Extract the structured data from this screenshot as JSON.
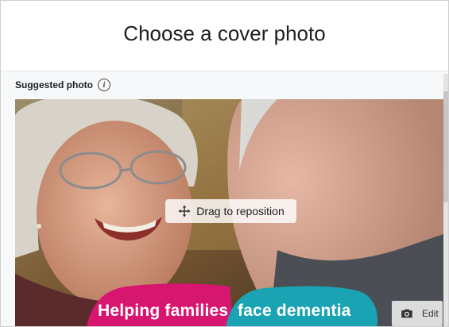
{
  "dialog": {
    "title": "Choose a cover photo",
    "section_label": "Suggested photo",
    "info_icon": "info-icon"
  },
  "photo": {
    "drag_label": "Drag to reposition",
    "edit_label": "Edit",
    "banner_left": "Helping families",
    "banner_right": "face dementia",
    "banner_left_color": "#d6166f",
    "banner_right_color": "#1aa3b3"
  }
}
